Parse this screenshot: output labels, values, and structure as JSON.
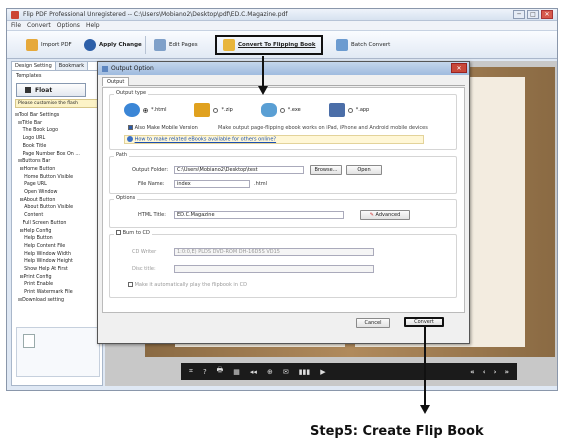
{
  "window": {
    "title": "Flip PDF Professional Unregistered -- C:\\Users\\Mobiano2\\Desktop\\pdf\\ED.C.Magazine.pdf",
    "min": "─",
    "max": "□",
    "close": "✕"
  },
  "menu": [
    "File",
    "Convert",
    "Options",
    "Help"
  ],
  "toolbar": {
    "import": "Import PDF",
    "apply": "Apply Change",
    "edit": "Edit Pages",
    "convert": "Convert To Flipping Book",
    "batch": "Batch Convert"
  },
  "left_panel": {
    "tabs": [
      "Design Setting",
      "Bookmark"
    ],
    "templates_label": "Templates",
    "template_value": "Float",
    "customise_hint": "Please customise the flash",
    "tree": [
      "⊟Tool Bar Settings",
      "  ⊟Title Bar",
      "     The Book Logo",
      "     Logo URL",
      "     Book Title",
      "     Page Number Box On ...",
      "  ⊟Buttons Bar",
      "   ⊟Home Button",
      "      Home Button Visible",
      "      Page URL",
      "      Open Window",
      "   ⊟About Button",
      "      About Button Visible",
      "      Content",
      "     Full Screen Button",
      "   ⊟Help Config",
      "      Help Button",
      "      Help Content File",
      "      Help Window Width",
      "      Help Window Height",
      "      Show Help At First",
      "   ⊟Print Config",
      "      Print Enable",
      "      Print Watermark File",
      "  ⊟Download setting"
    ]
  },
  "book_toolbar": {
    "icons": [
      "⌗",
      "?",
      "🖶",
      "▦",
      "◂◂",
      "⊕",
      "✉",
      "▮▮▮",
      "▶"
    ],
    "nav": [
      "«",
      "‹",
      "›",
      "»"
    ]
  },
  "dialog": {
    "title": "Output Option",
    "close": "✕",
    "tab": "Output",
    "output_type": {
      "legend": "Output type",
      "formats": [
        {
          "label": "*.html",
          "selected": true,
          "color": "#3b86d6"
        },
        {
          "label": "*.zip",
          "selected": false,
          "color": "#e0a11f"
        },
        {
          "label": "*.exe",
          "selected": false,
          "color": "#5a9fd4"
        },
        {
          "label": "*.app",
          "selected": false,
          "color": "#4b6ea8"
        }
      ],
      "mobile_checkbox": "Also Make Mobile Version",
      "mobile_hint": "Make output page-flipping ebook works on iPad, iPhone and Android mobile devices",
      "share_link": "How to make related eBooks available for others online?"
    },
    "path": {
      "legend": "Path",
      "folder_label": "Output Folder:",
      "folder_value": "C:\\Users\\Mobiano2\\Desktop\\test",
      "browse": "Browse...",
      "open": "Open",
      "file_label": "File Name:",
      "file_value": "index",
      "file_ext": ".html"
    },
    "options": {
      "legend": "Options",
      "html_title_label": "HTML Title:",
      "html_title_value": "ED.C.Magazine",
      "advanced": "Advanced"
    },
    "cd": {
      "legend": "Burn to CD",
      "writer_label": "CD Writer",
      "writer_value": "1:0:0,E) PLDS    DVD-ROM DH-16D5S VD15",
      "disc_label": "Disc title:",
      "autoplay": "Make it automatically play the flipbook in CD"
    },
    "cancel": "Cancel",
    "convert": "Convert"
  },
  "caption": "Step5: Create Flip Book"
}
